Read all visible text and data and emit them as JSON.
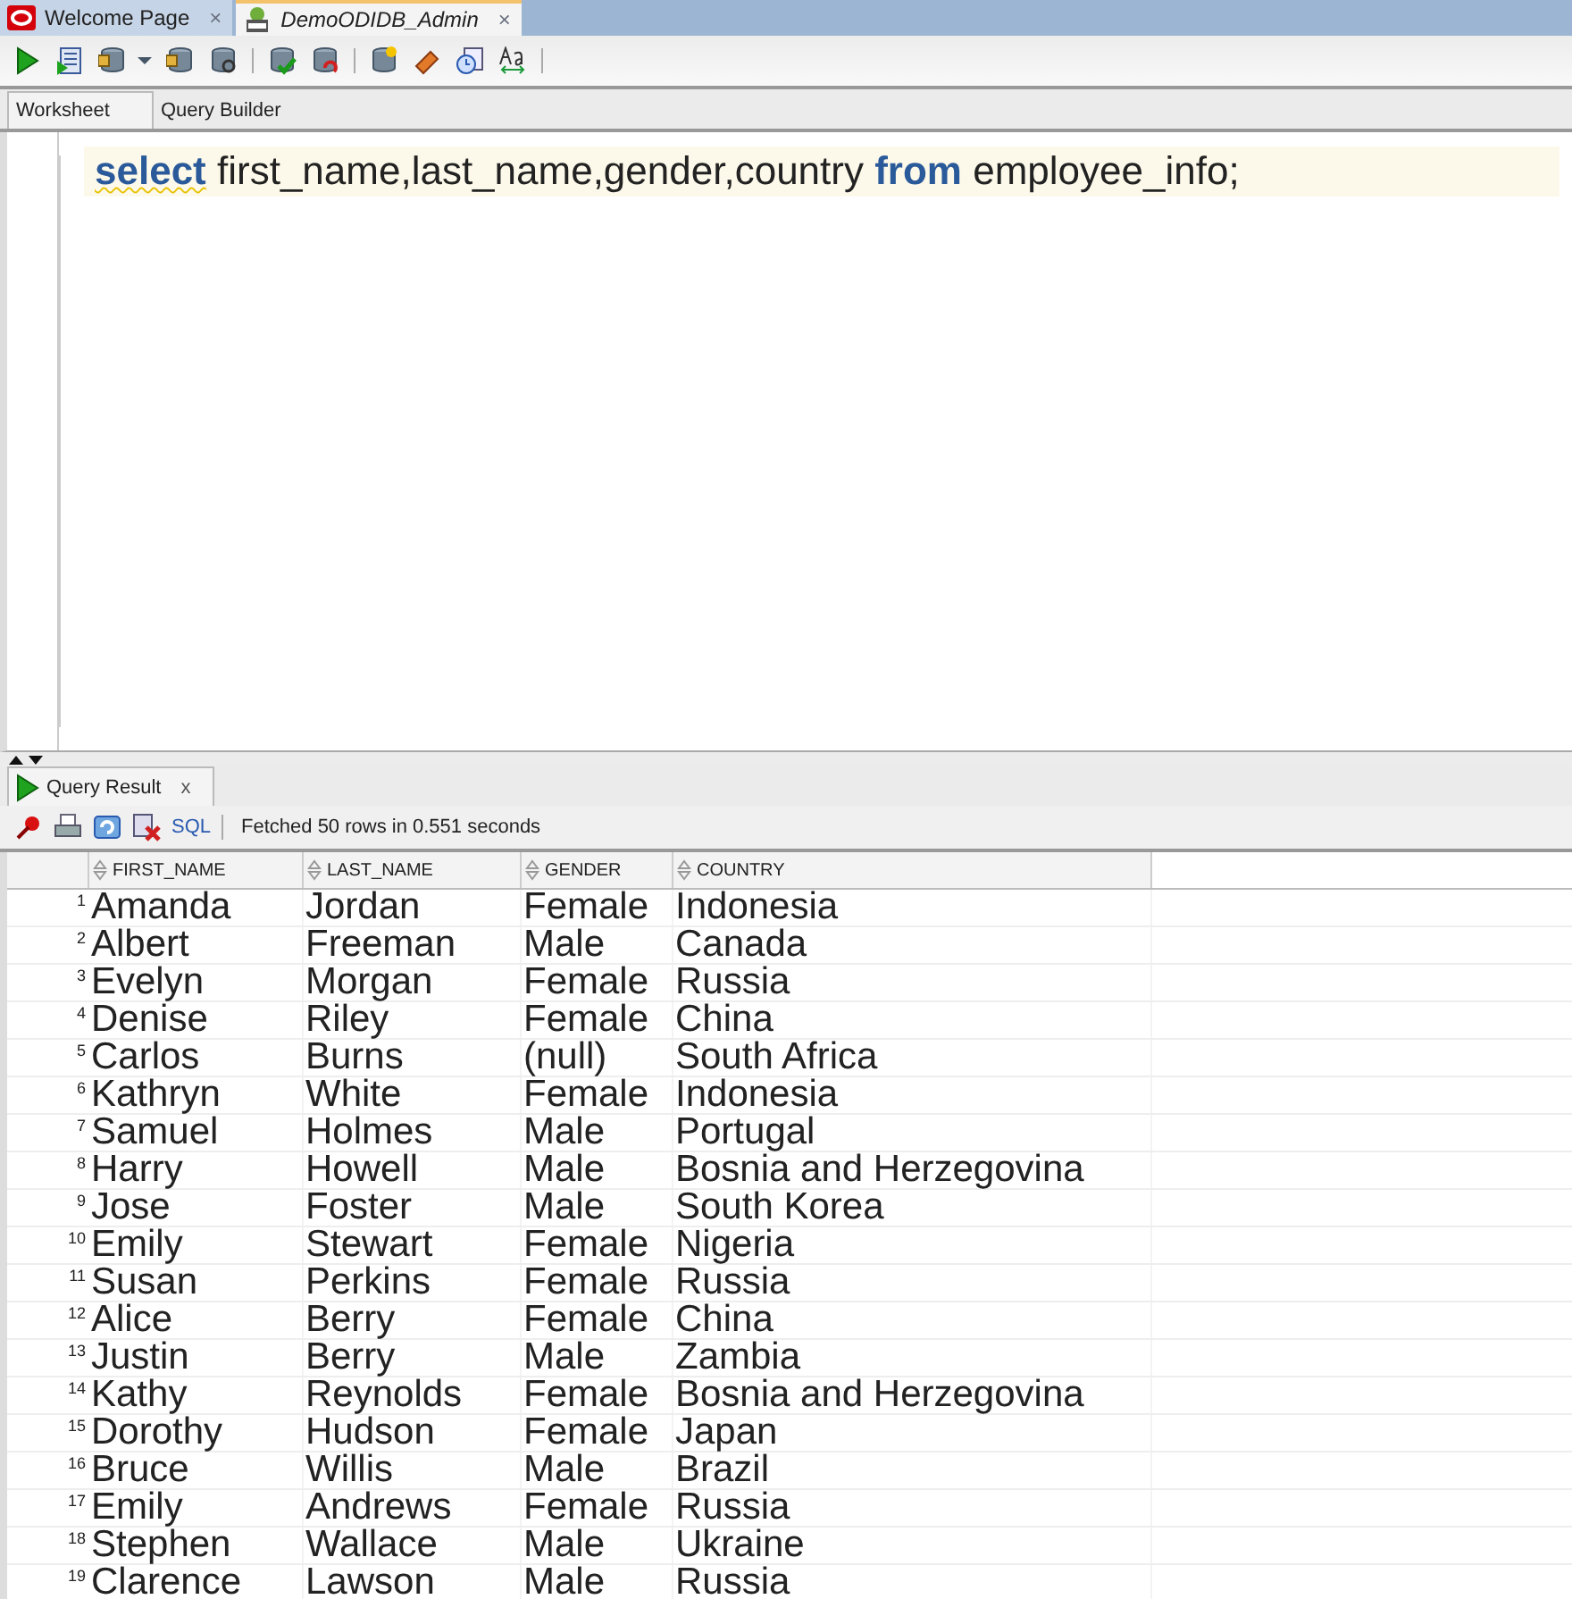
{
  "doc_tabs": [
    {
      "label": "Welcome Page",
      "selected": false,
      "kind": "oracle",
      "close": "×"
    },
    {
      "label": "DemoODIDB_Admin",
      "selected": true,
      "kind": "sql",
      "close": "×"
    }
  ],
  "editor_tabs": [
    {
      "label": "Worksheet",
      "selected": true
    },
    {
      "label": "Query Builder",
      "selected": false
    }
  ],
  "editor": {
    "tokens": [
      {
        "text": "select",
        "kind": "keyword"
      },
      {
        "text": " first_name,last_name,gender,country ",
        "kind": "text"
      },
      {
        "text": "from",
        "kind": "keyword"
      },
      {
        "text": " employee_info;",
        "kind": "text"
      }
    ]
  },
  "result_tab": {
    "label": "Query Result",
    "close": "x"
  },
  "result_toolbar": {
    "sql_link": "SQL",
    "status": "Fetched 50 rows in 0.551 seconds"
  },
  "table": {
    "columns": [
      "FIRST_NAME",
      "LAST_NAME",
      "GENDER",
      "COUNTRY"
    ],
    "rows": [
      {
        "num": "1",
        "cells": [
          "Amanda",
          "Jordan",
          "Female",
          "Indonesia"
        ]
      },
      {
        "num": "2",
        "cells": [
          "Albert",
          "Freeman",
          "Male",
          "Canada"
        ]
      },
      {
        "num": "3",
        "cells": [
          "Evelyn",
          "Morgan",
          "Female",
          "Russia"
        ]
      },
      {
        "num": "4",
        "cells": [
          "Denise",
          "Riley",
          "Female",
          "China"
        ]
      },
      {
        "num": "5",
        "cells": [
          "Carlos",
          "Burns",
          "(null)",
          "South Africa"
        ]
      },
      {
        "num": "6",
        "cells": [
          "Kathryn",
          "White",
          "Female",
          "Indonesia"
        ]
      },
      {
        "num": "7",
        "cells": [
          "Samuel",
          "Holmes",
          "Male",
          "Portugal"
        ]
      },
      {
        "num": "8",
        "cells": [
          "Harry",
          "Howell",
          "Male",
          "Bosnia and Herzegovina"
        ]
      },
      {
        "num": "9",
        "cells": [
          "Jose",
          "Foster",
          "Male",
          "South Korea"
        ]
      },
      {
        "num": "10",
        "cells": [
          "Emily",
          "Stewart",
          "Female",
          "Nigeria"
        ]
      },
      {
        "num": "11",
        "cells": [
          "Susan",
          "Perkins",
          "Female",
          "Russia"
        ]
      },
      {
        "num": "12",
        "cells": [
          "Alice",
          "Berry",
          "Female",
          "China"
        ]
      },
      {
        "num": "13",
        "cells": [
          "Justin",
          "Berry",
          "Male",
          "Zambia"
        ]
      },
      {
        "num": "14",
        "cells": [
          "Kathy",
          "Reynolds",
          "Female",
          "Bosnia and Herzegovina"
        ]
      },
      {
        "num": "15",
        "cells": [
          "Dorothy",
          "Hudson",
          "Female",
          "Japan"
        ]
      },
      {
        "num": "16",
        "cells": [
          "Bruce",
          "Willis",
          "Male",
          "Brazil"
        ]
      },
      {
        "num": "17",
        "cells": [
          "Emily",
          "Andrews",
          "Female",
          "Russia"
        ]
      },
      {
        "num": "18",
        "cells": [
          "Stephen",
          "Wallace",
          "Male",
          "Ukraine"
        ]
      },
      {
        "num": "19",
        "cells": [
          "Clarence",
          "Lawson",
          "Male",
          "Russia"
        ]
      }
    ]
  }
}
